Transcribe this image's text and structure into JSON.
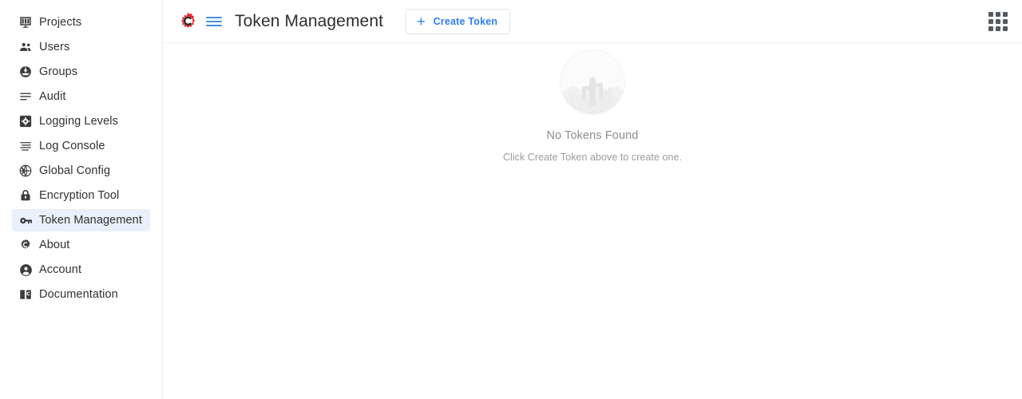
{
  "app": {
    "logo_icon": "red-gear-c-logo",
    "accent_blue": "#2e7df6",
    "logo_red": "#e8231f",
    "selected_bg": "#e8f0fb"
  },
  "sidebar": {
    "items": [
      {
        "label": "Projects",
        "icon": "dashboard-icon",
        "key": "projects",
        "selected": false
      },
      {
        "label": "Users",
        "icon": "users-icon",
        "key": "users",
        "selected": false
      },
      {
        "label": "Groups",
        "icon": "groups-icon",
        "key": "groups",
        "selected": false
      },
      {
        "label": "Audit",
        "icon": "list-lines-icon",
        "key": "audit",
        "selected": false
      },
      {
        "label": "Logging Levels",
        "icon": "gear-square-icon",
        "key": "logging-levels",
        "selected": false
      },
      {
        "label": "Log Console",
        "icon": "console-lines-icon",
        "key": "log-console",
        "selected": false
      },
      {
        "label": "Global Config",
        "icon": "globe-icon",
        "key": "global-config",
        "selected": false
      },
      {
        "label": "Encryption Tool",
        "icon": "lock-icon",
        "key": "encryption-tool",
        "selected": false
      },
      {
        "label": "Token Management",
        "icon": "key-icon",
        "key": "token-management",
        "selected": true
      },
      {
        "label": "About",
        "icon": "gear-c-icon",
        "key": "about",
        "selected": false
      },
      {
        "label": "Account",
        "icon": "account-circle-icon",
        "key": "account",
        "selected": false
      },
      {
        "label": "Documentation",
        "icon": "book-icon",
        "key": "documentation",
        "selected": false
      }
    ]
  },
  "header": {
    "title": "Token Management",
    "menu_icon": "hamburger-icon",
    "logo_icon": "app-logo-icon",
    "apps_icon": "apps-grid-icon",
    "create_button": {
      "label": "Create Token",
      "plus": "+",
      "icon": "plus-icon"
    }
  },
  "empty_state": {
    "illustration": "desert-cactus-circle-illustration",
    "title": "No Tokens Found",
    "subtitle": "Click Create Token above to create one."
  }
}
